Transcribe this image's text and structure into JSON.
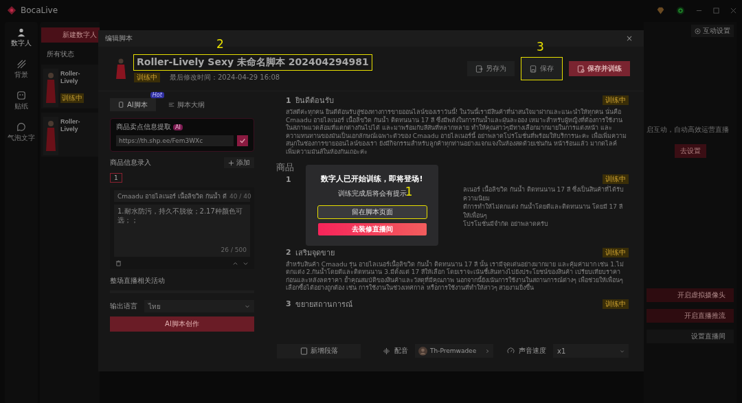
{
  "app": {
    "name": "BocaLive"
  },
  "nav": [
    {
      "label": "数字人",
      "selected": true
    },
    {
      "label": "背景",
      "selected": false
    },
    {
      "label": "贴纸",
      "selected": false
    },
    {
      "label": "气泡文字",
      "selected": false
    }
  ],
  "list_panel": {
    "new_button": "新建数字人",
    "filter": "所有状态",
    "cards": [
      {
        "title": "Roller-Lively",
        "status": "训练中"
      },
      {
        "title": "Roller-Lively"
      }
    ]
  },
  "right_panel": {
    "settings_button": "互动设置",
    "hint": "启互动，自动高效运营直播",
    "setup_button": "去设置",
    "actions": [
      {
        "label": "开启虚拟摄像头",
        "kind": "primary"
      },
      {
        "label": "开启直播推流",
        "kind": "primary"
      },
      {
        "label": "设置直播间",
        "kind": "plain"
      }
    ]
  },
  "modal": {
    "title": "编辑脚本",
    "close": "×",
    "script": {
      "title": "Roller-Lively Sexy 未命名脚本 202404294981",
      "callout": "2",
      "status": "训练中",
      "modified": "最后修改时间：2024-04-29 16:08"
    },
    "buttons": [
      {
        "label": "另存为",
        "kind": "plain"
      },
      {
        "label": "保存",
        "kind": "plain",
        "callout": "3"
      },
      {
        "label": "保存并训练",
        "kind": "primary"
      }
    ],
    "tabs": [
      {
        "label": "AI脚本",
        "selected": true,
        "badge": "Hot"
      },
      {
        "label": "脚本大纲",
        "selected": false
      }
    ],
    "extract": {
      "title": "商品卖点信息提取",
      "badge": "AI",
      "url": "https://th.shp.ee/Fem3WXc"
    },
    "product_section": {
      "title": "商品信息录入",
      "add_button": "添加",
      "index": "1",
      "name": "Cmaadu อายไลเนอร์ เนื้อลิขวิด กันน้ำ ดี",
      "name_count": "40 / 40",
      "details": "1.耐水防污，持久不脱妆；2.17种颜色可选；；",
      "details_count": "26 / 500"
    },
    "activity_title": "整场直播相关活动",
    "language": {
      "label": "输出语言",
      "value": "ไทย"
    },
    "generate_button": "AI脚本创作",
    "content": {
      "sections": [
        {
          "number": "1",
          "title": "ยินดีต้อนรับ",
          "status": "训练中",
          "text": "สวัสดีค่ะทุกคน ยินดีต้อนรับสู่ช่องทางการขายออนไลน์ของเราวันนี้! ในวันนี้เรามีสินค้าที่น่าสนใจมาฝากและแนะนำให้ทุกคน นั่นคือ Cmaadu อายไลเนอร์ เนื้อลิขวิด กันน้ำ ติดทนนาน 17 สี ซึ่งมีพลังในการกันน้ำและฝุ่นละออง เหมาะสำหรับผู้หญิงที่ต้องการใช้งานในสภาพแวดล้อมที่แตกต่างกันไปได้ และมาพร้อมกับสีสันที่หลากหลาย ทำให้คุณสาวๆมีทางเลือกมากมายในการแต่งหน้า และ ความทนทานของมันเป็นเอกลักษณ์เฉพาะตัวของ Cmaadu อายไลเนอร์นี้ อย่าพลาดโปรโมชั่นที่พร้อมให้บริการนะคะ เพื่อเพิ่มความสนุกในช่องการขายออนไลน์ของเรา ยังมีกิจกรรมสำหรับลูกค้าทุกท่านอย่างแจกแจงในห้องสดด้วยเช่นกัน หน้าร้อนแล้ว มากดไลค์ เพิ่มความมันส์ในห้องกันเถอะค่ะ"
        }
      ],
      "group_title": "商品",
      "hidden_section": {
        "number": "1",
        "status": "训练中",
        "lines": [
          "ลเนอร์ เนื้อลิขวิด กันน้ำ ติดทนนาน 17 สี ซึ่งเป็นสินค้าที่ได้รับความนิยม",
          "ดีการทำให้ไม่ตกแต่ง กันน้ำโดยดีและติดทนนาน โดยมี 17 สีให้เพื่อนๆ",
          "โปรโมชั่นมีจำกัด อย่าพลาดครับ"
        ]
      },
      "more_sections": [
        {
          "number": "2",
          "title": "เสริมจุดขาย",
          "status": "训练中",
          "text": "สำหรับสินค้า Cmaadu รุ่น อายไลเนอร์เนื้อลิขวิด กันน้ำ ติดทนนาน 17 สี นั้น เรามีจุดเด่นอย่างมากมาย และคุ้มค่ามาก เช่น 1.ไม่ตกแต่ง 2.กันน้ำโดยดีและติดทนนาน 3.มีตั้งแต่ 17 สีให้เลือก โดยเราจะเน้นชี้เส้นทางไปยังประโยชน์ของสินค้า เปรียบเทียบราคาก่อนและหลังลดราคา ย้ำคุณสมบัติของสินค้าและวัสดุที่มีคุณภาพ นอกจากนี้ยังเน้นการใช้งานในสถานการณ์ต่างๆ เพื่อช่วยให้เพื่อนๆ เลือกซื้อได้อย่างถูกต้อง เช่น การใช้งานในช่วงเทศกาล หรือการใช้งานที่ทำให้สาวๆ สวยงามยิ่งขึ้น"
        },
        {
          "number": "3",
          "title": "ขยายสถานการณ์",
          "status": "训练中"
        }
      ]
    },
    "footer": {
      "add_button": "新增段落",
      "voice_label": "配音",
      "voice": "Th-Premwadee",
      "speed_label": "声音速度",
      "speed": "x1"
    }
  },
  "dialog": {
    "title": "数字人已开始训练，即将登场!",
    "subtitle": "训练完成后将会有提示",
    "buttons": [
      {
        "label": "留在脚本页面",
        "kind": "plain",
        "callout": "1"
      },
      {
        "label": "去装修直播间",
        "kind": "primary"
      }
    ]
  }
}
